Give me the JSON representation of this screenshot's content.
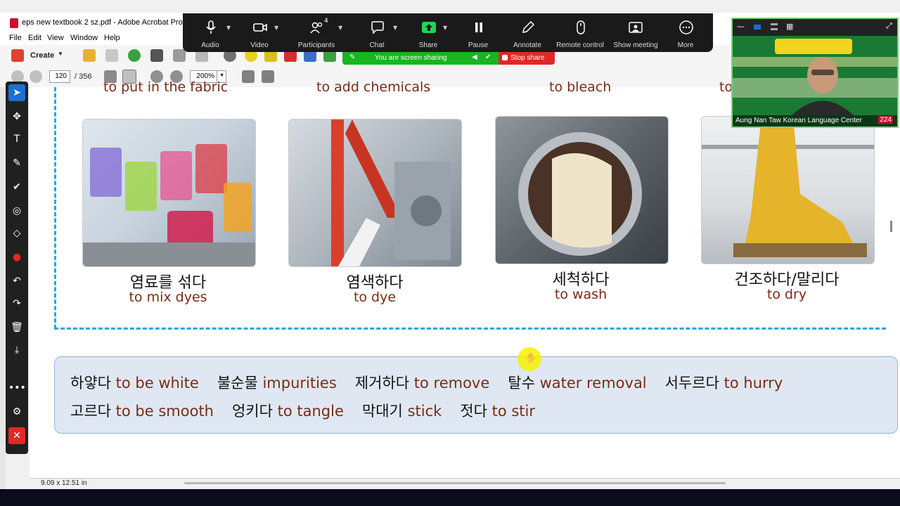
{
  "window": {
    "title": "eps new textbook 2 sz.pdf - Adobe Acrobat Pro",
    "menu": [
      "File",
      "Edit",
      "View",
      "Window",
      "Help"
    ]
  },
  "toolbar": {
    "create_label": "Create",
    "page_current": "120",
    "page_total": "/ 356",
    "zoom_value": "200%"
  },
  "status": {
    "page_size": "9.09 x 12.51 in"
  },
  "page": {
    "cut_labels": [
      "to put in the fabric",
      "to add chemicals",
      "to bleach",
      "to"
    ],
    "cards": [
      {
        "korean": "염료를 섞다",
        "english": "to mix dyes"
      },
      {
        "korean": "염색하다",
        "english": "to dye"
      },
      {
        "korean": "세척하다",
        "english": "to wash"
      },
      {
        "korean": "건조하다/말리다",
        "english": "to dry"
      }
    ],
    "vocab_row1": [
      {
        "k": "하얗다",
        "e": "to be white"
      },
      {
        "k": "불순물",
        "e": "impurities"
      },
      {
        "k": "제거하다",
        "e": "to remove"
      },
      {
        "k": "탈수",
        "e": "water removal"
      },
      {
        "k": "서두르다",
        "e": "to hurry"
      }
    ],
    "vocab_row2": [
      {
        "k": "고르다",
        "e": "to be smooth"
      },
      {
        "k": "엉키다",
        "e": "to tangle"
      },
      {
        "k": "막대기",
        "e": "stick"
      },
      {
        "k": "젓다",
        "e": "to stir"
      }
    ]
  },
  "zoom_bar": {
    "buttons": [
      "Audio",
      "Video",
      "Participants",
      "Chat",
      "Share",
      "Pause",
      "Annotate",
      "Remote control",
      "Show meeting",
      "More"
    ],
    "participants_count": "4",
    "share_banner": "You are screen sharing",
    "stop_share": "Stop share"
  },
  "video": {
    "name": "Aung Nan Taw Korean Language Center",
    "count": "224"
  },
  "colors": {
    "accent_blue": "#27a9d6",
    "english_brown": "#7a2b18",
    "share_green": "#17b51f",
    "stop_red": "#e02828"
  }
}
